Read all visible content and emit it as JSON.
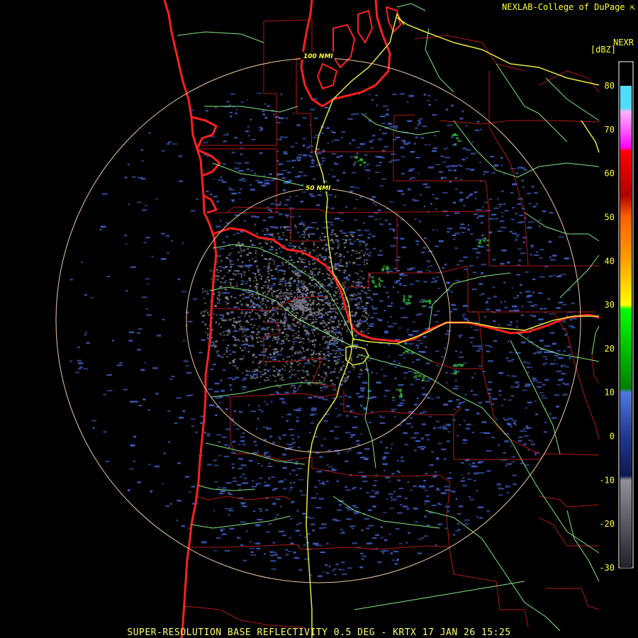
{
  "credit": "NEXLAB-College of DuPage",
  "product": "NEXR",
  "unit": "[dBZ]",
  "footer": "SUPER-RESOLUTION BASE REFLECTIVITY 0.5 DEG - KRTX 17 JAN 26 15:25",
  "range_rings": [
    {
      "label": "100 NMI"
    },
    {
      "label": "50 NMI"
    }
  ],
  "color_scale": {
    "ticks": [
      "80",
      "70",
      "60",
      "50",
      "40",
      "30",
      "20",
      "10",
      "0",
      "-10",
      "-20",
      "-30"
    ],
    "max_dbz": 80,
    "min_dbz": -30,
    "stops": [
      {
        "dbz": 80,
        "color": "#50dcff"
      },
      {
        "dbz": 75,
        "color": "#50dcff"
      },
      {
        "dbz": 74,
        "color": "#ffb0ff"
      },
      {
        "dbz": 70,
        "color": "#ff60ff"
      },
      {
        "dbz": 66,
        "color": "#ff00ff"
      },
      {
        "dbz": 65,
        "color": "#ff0000"
      },
      {
        "dbz": 55,
        "color": "#b00000"
      },
      {
        "dbz": 50,
        "color": "#ff6000"
      },
      {
        "dbz": 40,
        "color": "#ffa000"
      },
      {
        "dbz": 30,
        "color": "#ffff00"
      },
      {
        "dbz": 29,
        "color": "#00ff00"
      },
      {
        "dbz": 20,
        "color": "#00c000"
      },
      {
        "dbz": 11,
        "color": "#008000"
      },
      {
        "dbz": 10,
        "color": "#5078e0"
      },
      {
        "dbz": 0,
        "color": "#203890"
      },
      {
        "dbz": -9,
        "color": "#101850"
      },
      {
        "dbz": -10,
        "color": "#909098"
      },
      {
        "dbz": -30,
        "color": "#202028"
      }
    ]
  },
  "colors": {
    "coast": "#ff2020",
    "state": "#ff3030",
    "county": "#b01818",
    "highway": "#e8e840",
    "road": "#80e880",
    "ring": "#f0c8a0",
    "low_echo": "#4060c8",
    "gray_echo": "#7c7c88",
    "green_echo": "#30b030"
  }
}
